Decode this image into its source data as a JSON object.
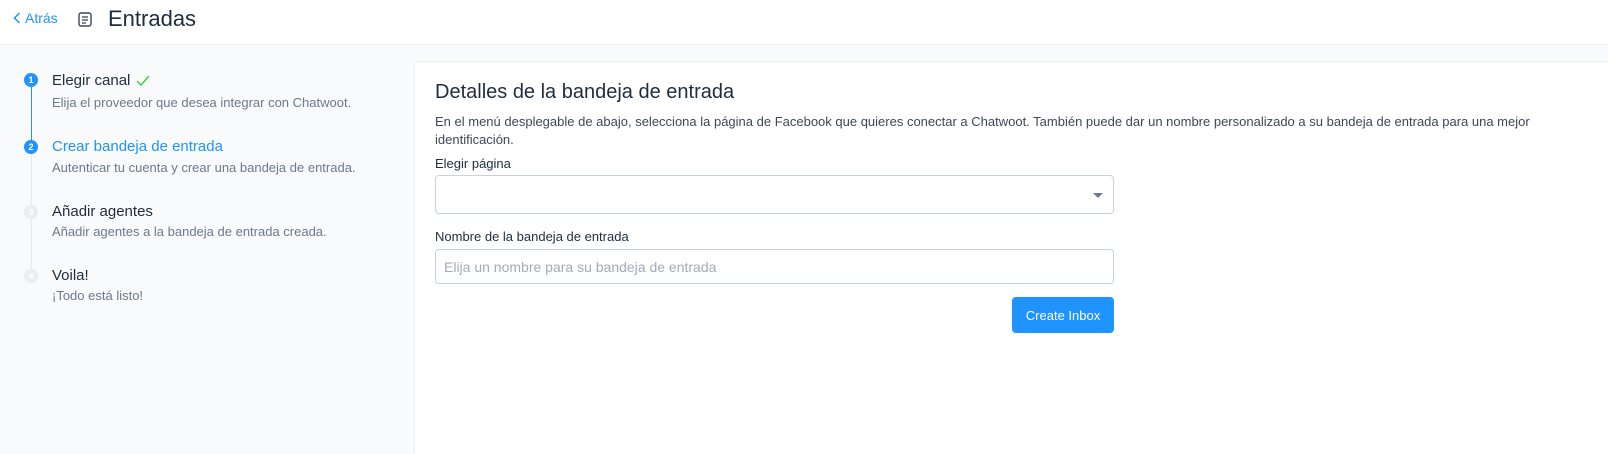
{
  "header": {
    "back_label": "Atrás",
    "title": "Entradas",
    "icons": {
      "back": "chevron-left-icon",
      "page": "inbox-icon"
    }
  },
  "steps": [
    {
      "number": "1",
      "title": "Elegir canal",
      "description": "Elija el proveedor que desea integrar con Chatwoot.",
      "state": "completed"
    },
    {
      "number": "2",
      "title": "Crear bandeja de entrada",
      "description": "Autenticar tu cuenta y crear una bandeja de entrada.",
      "state": "current"
    },
    {
      "number": "3",
      "title": "Añadir agentes",
      "description": "Añadir agentes a la bandeja de entrada creada.",
      "state": "pending"
    },
    {
      "number": "4",
      "title": "Voila!",
      "description": "¡Todo está listo!",
      "state": "pending"
    }
  ],
  "panel": {
    "title": "Detalles de la bandeja de entrada",
    "description": "En el menú desplegable de abajo, selecciona la página de Facebook que quieres conectar a Chatwoot. También puede dar un nombre personalizado a su bandeja de entrada para una mejor identificación.",
    "page_select": {
      "label": "Elegir página",
      "value": ""
    },
    "inbox_name": {
      "label": "Nombre de la bandeja de entrada",
      "placeholder": "Elija un nombre para su bandeja de entrada",
      "value": ""
    },
    "create_button_label": "Create Inbox"
  },
  "colors": {
    "accent": "#1f93ff",
    "text": "#1f2d3d",
    "muted": "#6b7a8c",
    "background": "#f8fafc"
  }
}
